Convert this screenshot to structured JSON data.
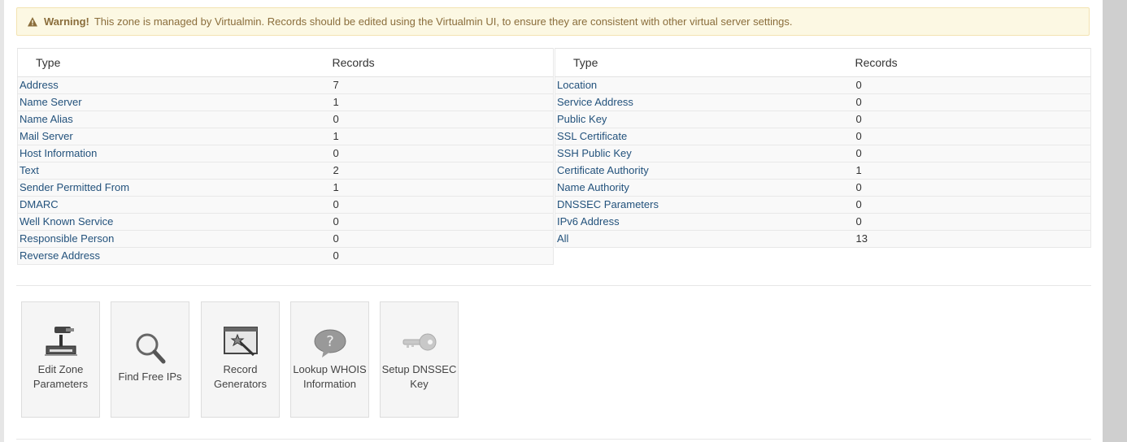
{
  "alert": {
    "title": "Warning!",
    "message": "This zone is managed by Virtualmin. Records should be edited using the Virtualmin UI, to ensure they are consistent with other virtual server settings."
  },
  "table_left": {
    "headers": [
      "Type",
      "Records"
    ],
    "rows": [
      {
        "type": "Address",
        "count": "7"
      },
      {
        "type": "Name Server",
        "count": "1"
      },
      {
        "type": "Name Alias",
        "count": "0"
      },
      {
        "type": "Mail Server",
        "count": "1"
      },
      {
        "type": "Host Information",
        "count": "0"
      },
      {
        "type": "Text",
        "count": "2"
      },
      {
        "type": "Sender Permitted From",
        "count": "1"
      },
      {
        "type": "DMARC",
        "count": "0"
      },
      {
        "type": "Well Known Service",
        "count": "0"
      },
      {
        "type": "Responsible Person",
        "count": "0"
      },
      {
        "type": "Reverse Address",
        "count": "0"
      }
    ]
  },
  "table_right": {
    "headers": [
      "Type",
      "Records"
    ],
    "rows": [
      {
        "type": "Location",
        "count": "0"
      },
      {
        "type": "Service Address",
        "count": "0"
      },
      {
        "type": "Public Key",
        "count": "0"
      },
      {
        "type": "SSL Certificate",
        "count": "0"
      },
      {
        "type": "SSH Public Key",
        "count": "0"
      },
      {
        "type": "Certificate Authority",
        "count": "1"
      },
      {
        "type": "Name Authority",
        "count": "0"
      },
      {
        "type": "DNSSEC Parameters",
        "count": "0"
      },
      {
        "type": "IPv6 Address",
        "count": "0"
      },
      {
        "type": "All",
        "count": "13"
      }
    ]
  },
  "tiles": [
    {
      "line1": "Edit Zone",
      "line2": "Parameters",
      "icon": "projector-icon"
    },
    {
      "line1": "Find Free IPs",
      "line2": "",
      "icon": "magnifier-icon"
    },
    {
      "line1": "Record",
      "line2": "Generators",
      "icon": "wizard-window-icon"
    },
    {
      "line1": "Lookup WHOIS",
      "line2": "Information",
      "icon": "question-bubble-icon"
    },
    {
      "line1": "Setup DNSSEC",
      "line2": "Key",
      "icon": "key-icon"
    }
  ],
  "colors": {
    "alert_bg": "#fcf8e3",
    "alert_text": "#8a6d3b",
    "link": "#23527c"
  }
}
